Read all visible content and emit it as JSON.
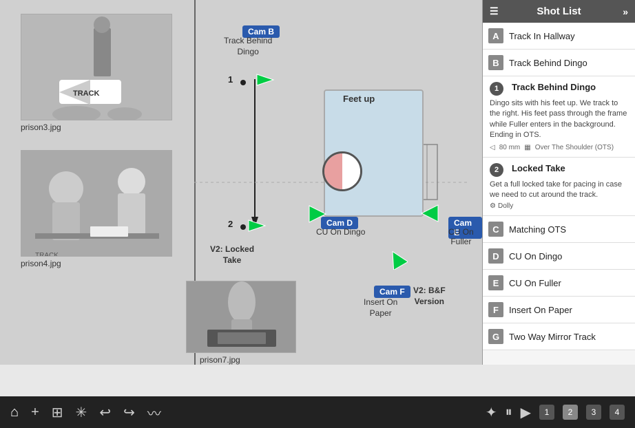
{
  "header": {
    "title": "Shot List",
    "menu_icon": "☰",
    "arrow_icon": "»"
  },
  "shot_list": {
    "letter_items": [
      {
        "id": "A",
        "title": "Track In Hallway"
      },
      {
        "id": "B",
        "title": "Track Behind Dingo"
      }
    ],
    "detail_items": [
      {
        "number": "1",
        "title": "Track Behind Dingo",
        "description": "Dingo sits with his feet up. We track to the right. His feet pass through the frame while Fuller enters in the background. Ending in OTS.",
        "lens": "80 mm",
        "shot_type": "Over The Shoulder (OTS)"
      },
      {
        "number": "2",
        "title": "Locked Take",
        "description": "Get a full locked take for pacing in case we need to cut around the track.",
        "dolly": "Dolly"
      }
    ],
    "more_items": [
      {
        "id": "C",
        "title": "Matching OTS"
      },
      {
        "id": "D",
        "title": "CU On Dingo"
      },
      {
        "id": "E",
        "title": "CU On Fuller"
      },
      {
        "id": "F",
        "title": "Insert On Paper"
      },
      {
        "id": "G",
        "title": "Two Way Mirror Track"
      }
    ]
  },
  "diagram": {
    "cam_b_label": "Cam B",
    "cam_b_desc": "Track Behind\nDingo",
    "cam_d_label": "Cam D",
    "cam_d_desc": "CU On Dingo",
    "cam_e_label": "Cam E",
    "cam_e_desc": "CU On\nFuller",
    "cam_f_label": "Cam F",
    "cam_f_desc": "Insert On\nPaper",
    "feet_up": "Feet up",
    "shot1_label": "1",
    "shot2_label": "2",
    "v2_locked": "V2: Locked\nTake",
    "v2_bf": "V2: B&F\nVersion"
  },
  "storyboard": {
    "prison3_label": "prison3.jpg",
    "prison4_label": "prison4.jpg",
    "prison7_label": "prison7.jpg"
  },
  "toolbar": {
    "icons": [
      "⌂",
      "+",
      "⊞",
      "✳",
      "↩",
      "↪",
      "〰"
    ],
    "right_icons": [
      "✦",
      "⏸",
      "▶"
    ],
    "pages": [
      "1",
      "2",
      "3",
      "4"
    ]
  },
  "colors": {
    "cam_badge": "#2a5aad",
    "toolbar_bg": "#1a1a1a",
    "shot_list_bg": "#f0f0f0",
    "header_bg": "#555555",
    "letter_badge": "#888888",
    "detail_number_bg": "#555555",
    "accent_green": "#00cc44"
  }
}
